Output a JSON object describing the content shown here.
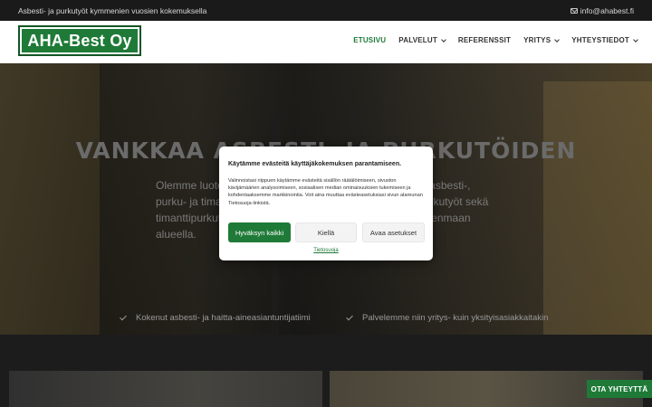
{
  "topbar": {
    "tagline": "Asbesti- ja purkutyöt kymmenien vuosien kokemuksella",
    "email": "info@ahabest.fi"
  },
  "header": {
    "logo_text": "AHA-Best Oy",
    "nav": [
      {
        "label": "ETUSIVU",
        "active": true,
        "dropdown": false
      },
      {
        "label": "PALVELUT",
        "active": false,
        "dropdown": true
      },
      {
        "label": "REFERENSSIT",
        "active": false,
        "dropdown": false
      },
      {
        "label": "YRITYS",
        "active": false,
        "dropdown": true
      },
      {
        "label": "YHTEYSTIEDOT",
        "active": false,
        "dropdown": true
      }
    ]
  },
  "hero": {
    "title": "VANKKAA ASBESTI- JA PURKUTÖIDEN OSAAMISTA",
    "text": "Olemme luotettava kumppani, joka tarjoaa asiantuntevia asbesti-, purku- ja timanttityöpalveluita. Toteutamme asbesti- ja purkutyöt sekä timanttipurkutyöt luotettavasti pääkaupunkiseudun ja Uudenmaan alueella.",
    "checks": [
      "Kokenut asbesti- ja haitta-aineasiantuntijatiimi",
      "Palvelemme niin yritys- kuin yksityisasiakkaitakin"
    ]
  },
  "contact_button": "OTA YHTEYTTÄ",
  "cookie_modal": {
    "title": "Käytämme evästeitä käyttäjäkokemuksen parantamiseen.",
    "text": "Valinnoistasi riippuen käytämme evästeitä sisällön räätälöimiseen, sivuston kävijämäärien analysoimiseen, sosiaalisen median ominaisuuksien tukemiseen ja kohdentaaksemme markkinointia. Voit aina muuttaa evästeasetuksiasi sivun alareunan Tietosuoja-linkistä.",
    "accept_label": "Hyväksyn kaikki",
    "deny_label": "Kiellä",
    "settings_label": "Avaa asetukset",
    "privacy_link": "Tietosuoja"
  },
  "colors": {
    "brand_green": "#1f7a38",
    "topbar_bg": "#1a1a1a"
  }
}
